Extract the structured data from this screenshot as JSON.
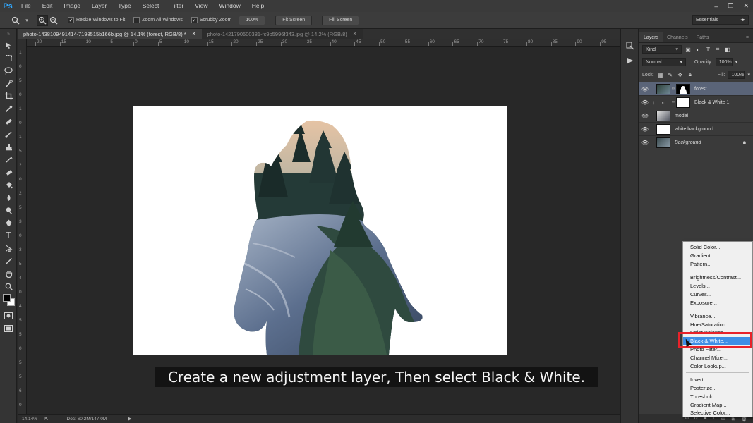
{
  "app": {
    "logo": "Ps"
  },
  "menu": [
    "File",
    "Edit",
    "Image",
    "Layer",
    "Type",
    "Select",
    "Filter",
    "View",
    "Window",
    "Help"
  ],
  "window_controls": {
    "minimize": "–",
    "restore": "❐",
    "close": "✕"
  },
  "options": {
    "resize_windows": "Resize Windows to Fit",
    "zoom_all": "Zoom All Windows",
    "scrubby_zoom": "Scrubby Zoom",
    "zoom_value": "100%",
    "fit_screen": "Fit Screen",
    "fill_screen": "Fill Screen",
    "workspace": "Essentials"
  },
  "tabs": [
    {
      "label": "photo-1438109491414-7198515b166b.jpg @ 14.1% (forest, RGB/8) *"
    },
    {
      "label": "photo-1421790500381-fc9b5996f343.jpg @ 14.2% (RGB/8)"
    }
  ],
  "ruler_h": [
    "20",
    "15",
    "10",
    "5",
    "0",
    "5",
    "10",
    "15",
    "20",
    "25",
    "30",
    "35",
    "40",
    "45",
    "50",
    "55",
    "60",
    "65",
    "70",
    "75",
    "80",
    "85",
    "90",
    "95"
  ],
  "ruler_v": [
    "1",
    "0",
    "5",
    "0",
    "1",
    "0",
    "1",
    "5",
    "2",
    "0",
    "2",
    "5",
    "3",
    "0",
    "3",
    "5",
    "4",
    "0",
    "4",
    "5",
    "5",
    "0",
    "5",
    "5",
    "6",
    "0"
  ],
  "status": {
    "zoom": "14.14%",
    "doc": "Doc: 60.2M/147.0M"
  },
  "layers_panel": {
    "tabs": [
      "Layers",
      "Channels",
      "Paths"
    ],
    "kind": "Kind",
    "blend_mode": "Normal",
    "opacity_label": "Opacity:",
    "opacity_value": "100%",
    "lock_label": "Lock:",
    "fill_label": "Fill:",
    "fill_value": "100%",
    "layers": [
      {
        "name": "forest"
      },
      {
        "name": "Black & White 1"
      },
      {
        "name": "model"
      },
      {
        "name": "white background"
      },
      {
        "name": "Background"
      }
    ]
  },
  "adjustment_menu": {
    "group1": [
      "Solid Color...",
      "Gradient...",
      "Pattern..."
    ],
    "group2": [
      "Brightness/Contrast...",
      "Levels...",
      "Curves...",
      "Exposure..."
    ],
    "group3": [
      "Vibrance...",
      "Hue/Saturation...",
      "Color Balance...",
      "Black & White...",
      "Photo Filter...",
      "Channel Mixer...",
      "Color Lookup..."
    ],
    "group4": [
      "Invert",
      "Posterize...",
      "Threshold...",
      "Gradient Map...",
      "Selective Color..."
    ],
    "highlighted": "Black & White..."
  },
  "caption": "Create a new adjustment layer, Then select Black & White.",
  "colors": {
    "accent": "#31a8ff",
    "highlight": "#3d8ee6",
    "callout": "#e8222a"
  }
}
